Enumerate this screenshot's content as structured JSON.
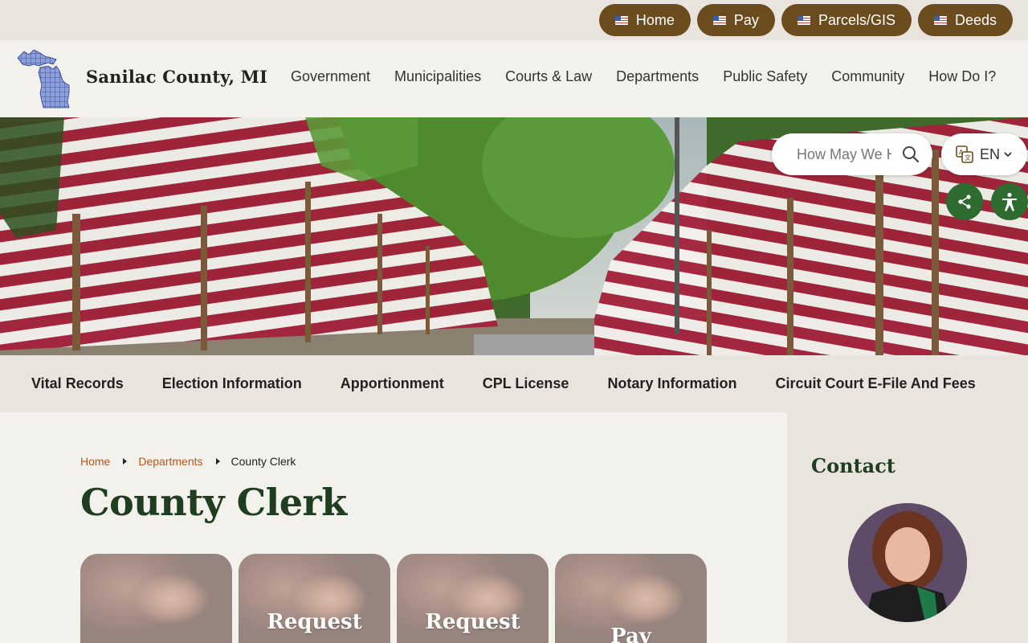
{
  "topbar": {
    "quick_links": [
      {
        "label": "Home"
      },
      {
        "label": "Pay"
      },
      {
        "label": "Parcels/GIS"
      },
      {
        "label": "Deeds"
      }
    ]
  },
  "header": {
    "site_name": "Sanilac County, MI",
    "nav": [
      "Government",
      "Municipalities",
      "Courts & Law",
      "Departments",
      "Public Safety",
      "Community",
      "How Do I?"
    ]
  },
  "hero": {
    "search_placeholder": "How May We Help?",
    "language": "EN"
  },
  "subnav": [
    "Vital Records",
    "Election Information",
    "Apportionment",
    "CPL License",
    "Notary Information",
    "Circuit Court E-File And Fees"
  ],
  "breadcrumb": {
    "home": "Home",
    "departments": "Departments",
    "current": "County Clerk"
  },
  "page_title": "County Clerk",
  "tiles": [
    {
      "label": ""
    },
    {
      "label": "Request"
    },
    {
      "label": "Request"
    },
    {
      "label": "Pay"
    }
  ],
  "sidebar": {
    "title": "Contact",
    "name": ""
  },
  "colors": {
    "accent_brown": "#6b4c1e",
    "title_green": "#1f3d1f",
    "link_orange": "#b4561f",
    "button_green": "#2e6b2e"
  }
}
